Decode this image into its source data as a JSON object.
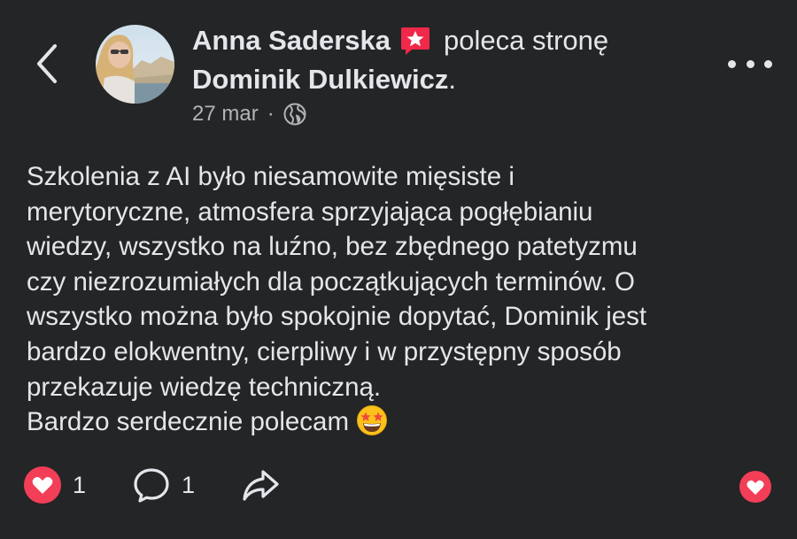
{
  "header": {
    "author_name": "Anna Saderska",
    "action_text": "poleca stronę",
    "page_name": "Dominik Dulkiewicz",
    "page_suffix": ".",
    "date": "27 mar",
    "separator": "·",
    "privacy_icon": "globe-icon",
    "recommend_icon": "recommend-badge-icon"
  },
  "post": {
    "lines": [
      "Szkolenia z AI było niesamowite mięsiste i",
      "merytoryczne, atmosfera sprzyjająca pogłębianiu",
      "wiedzy, wszystko na luźno, bez zbędnego patetyzmu",
      "czy niezrozumiałych dla początkujących terminów. O",
      "wszystko można było spokojnie dopytać, Dominik jest",
      "bardzo elokwentny, cierpliwy i w przystępny sposób",
      "przekazuje wiedzę techniczną.",
      "Bardzo serdecznie polecam"
    ],
    "emoji": "star-struck-emoji"
  },
  "footer": {
    "reaction_count": "1",
    "comment_count": "1",
    "icons": [
      "love-reaction-icon",
      "comment-icon",
      "share-icon",
      "love-icon"
    ]
  },
  "colors": {
    "background": "#242526",
    "text": "#e4e6eb",
    "secondary_text": "#b0b3b8",
    "love_red": "#f33e58",
    "recommend_red": "#f02849"
  }
}
